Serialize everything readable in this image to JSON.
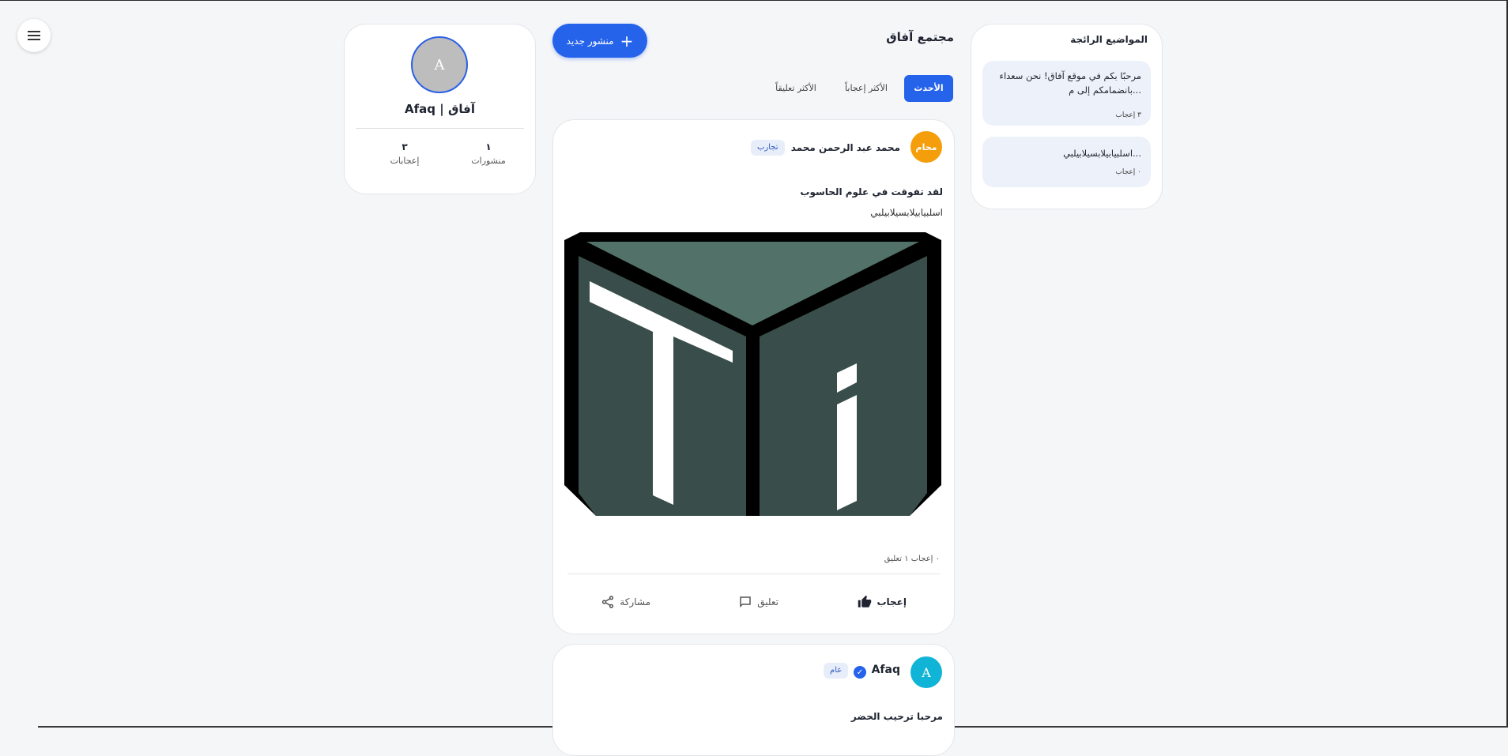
{
  "menu": {
    "icon": "hamburger-menu-icon"
  },
  "profile": {
    "avatar_letter": "A",
    "name": "Afaq | آفاق",
    "stats": [
      {
        "value": "١",
        "label": "منشورات"
      },
      {
        "value": "٣",
        "label": "إعجابات"
      }
    ]
  },
  "feed": {
    "new_post_label": "منشور جديد",
    "title": "مجتمع آفاق",
    "tabs": [
      {
        "label": "الأحدث",
        "active": true
      },
      {
        "label": "الأكثر إعجاباً",
        "active": false
      },
      {
        "label": "الأكثر تعليقاً",
        "active": false
      }
    ]
  },
  "posts": [
    {
      "avatar_text": "محام",
      "author": "محمد عبد الرحمن محمد",
      "tag": "تجارب",
      "title": "لقد تفوقت في علوم الحاسوب",
      "text": "اسلبيابيلابسيلابيلبي",
      "image_icon": "ti-cube-logo",
      "meta": "٠ إعجاب   ١ تعليق",
      "actions": {
        "like": "إعجاب",
        "comment": "تعليق",
        "share": "مشاركة"
      }
    },
    {
      "avatar_text": "A",
      "author": "Afaq",
      "tag": "عام",
      "title": "مرحبا ترحيب الحضر"
    }
  ],
  "side": {
    "title": "المواضيع الرائجة",
    "items": [
      {
        "text": "مرحبًا بكم في موقع آفاق! نحن سعداء بانضمامكم إلى م...",
        "likes": "٣ إعجاب"
      },
      {
        "text": "اسلبيابيلابسيلابيلبي...",
        "likes": "٠ إعجاب"
      }
    ]
  },
  "colors": {
    "accent": "#2563eb",
    "avatar_orange": "#f59e0b",
    "avatar_cyan": "#10b4d6",
    "tag_bg": "#e8eef9"
  }
}
